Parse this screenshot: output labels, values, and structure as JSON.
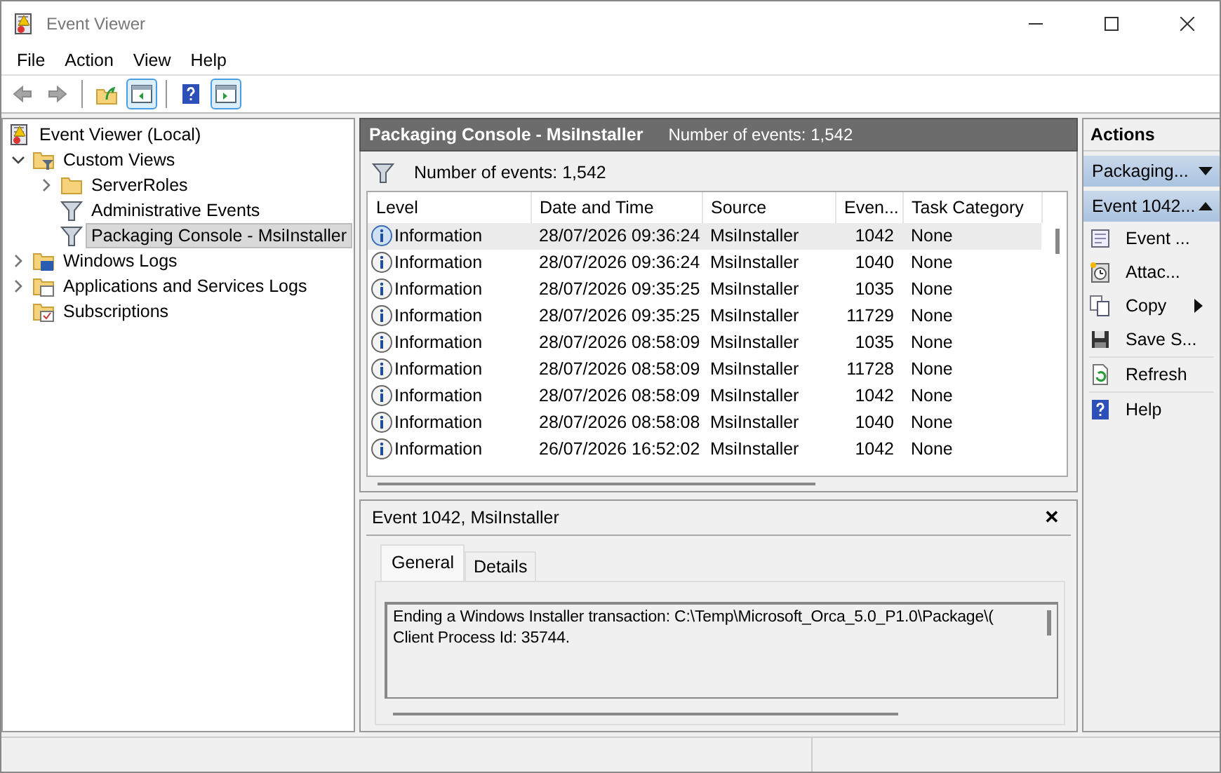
{
  "window": {
    "title": "Event Viewer"
  },
  "menu": [
    "File",
    "Action",
    "View",
    "Help"
  ],
  "toolbar": [
    {
      "kind": "back",
      "disabled": true
    },
    {
      "kind": "forward",
      "disabled": true
    },
    {
      "kind": "sep"
    },
    {
      "kind": "up",
      "disabled": false
    },
    {
      "kind": "pane-left",
      "disabled": false,
      "selected": true
    },
    {
      "kind": "sep"
    },
    {
      "kind": "help",
      "disabled": false
    },
    {
      "kind": "pane-right",
      "disabled": false,
      "selected": true
    }
  ],
  "tree": [
    {
      "label": "Event Viewer (Local)",
      "kind": "viewer",
      "selected": false,
      "children": [
        {
          "label": "Custom Views",
          "kind": "filter-folder",
          "expanded": true,
          "selected": false,
          "children": [
            {
              "label": "ServerRoles",
              "kind": "folder",
              "expanded": false,
              "selected": false
            },
            {
              "label": "Administrative Events",
              "kind": "filter",
              "selected": false
            },
            {
              "label": "Packaging Console - MsiInstaller",
              "kind": "filter",
              "selected": true
            }
          ]
        },
        {
          "label": "Windows Logs",
          "kind": "log-folder",
          "expanded": false,
          "selected": false
        },
        {
          "label": "Applications and Services Logs",
          "kind": "doc-folder",
          "expanded": false,
          "selected": false
        },
        {
          "label": "Subscriptions",
          "kind": "sub-folder",
          "selected": false
        }
      ]
    }
  ],
  "log_header": {
    "title": "Packaging Console - MsiInstaller",
    "count": "Number of events: 1,542"
  },
  "filter_bar": {
    "text": "Number of events: 1,542"
  },
  "table": {
    "columns": [
      "Level",
      "Date and Time",
      "Source",
      "Even...",
      "Task Category"
    ],
    "rows": [
      {
        "level": "Information",
        "date": "28/07/2026 09:36:24",
        "source": "MsiInstaller",
        "event": "1042",
        "category": "None",
        "selected": true
      },
      {
        "level": "Information",
        "date": "28/07/2026 09:36:24",
        "source": "MsiInstaller",
        "event": "1040",
        "category": "None",
        "selected": false
      },
      {
        "level": "Information",
        "date": "28/07/2026 09:35:25",
        "source": "MsiInstaller",
        "event": "1035",
        "category": "None",
        "selected": false
      },
      {
        "level": "Information",
        "date": "28/07/2026 09:35:25",
        "source": "MsiInstaller",
        "event": "11729",
        "category": "None",
        "selected": false
      },
      {
        "level": "Information",
        "date": "28/07/2026 08:58:09",
        "source": "MsiInstaller",
        "event": "1035",
        "category": "None",
        "selected": false
      },
      {
        "level": "Information",
        "date": "28/07/2026 08:58:09",
        "source": "MsiInstaller",
        "event": "11728",
        "category": "None",
        "selected": false
      },
      {
        "level": "Information",
        "date": "28/07/2026 08:58:09",
        "source": "MsiInstaller",
        "event": "1042",
        "category": "None",
        "selected": false
      },
      {
        "level": "Information",
        "date": "28/07/2026 08:58:08",
        "source": "MsiInstaller",
        "event": "1040",
        "category": "None",
        "selected": false
      },
      {
        "level": "Information",
        "date": "26/07/2026 16:52:02",
        "source": "MsiInstaller",
        "event": "1042",
        "category": "None",
        "selected": false
      }
    ]
  },
  "details": {
    "title": "Event 1042, MsiInstaller",
    "close": "✕",
    "tabs": [
      {
        "label": "General",
        "selected": true
      },
      {
        "label": "Details",
        "selected": false
      }
    ],
    "lines": [
      "Ending a Windows Installer transaction: C:\\Temp\\Microsoft_Orca_5.0_P1.0\\Package\\(",
      "Client Process Id: 35744."
    ]
  },
  "actions": {
    "title": "Actions",
    "sections": [
      {
        "label": "Packaging...",
        "expanded": false
      },
      {
        "label": "Event 1042...",
        "expanded": true,
        "items": [
          {
            "label": "Event ...",
            "kind": "properties",
            "submenu": false,
            "separator": false
          },
          {
            "label": "Attac...",
            "kind": "task",
            "submenu": false,
            "separator": false
          },
          {
            "label": "Copy",
            "kind": "copy",
            "submenu": true,
            "separator": false
          },
          {
            "label": "Save S...",
            "kind": "save",
            "submenu": false,
            "separator": false
          },
          {
            "label": "Refresh",
            "kind": "refresh",
            "submenu": false,
            "separator": true
          },
          {
            "label": "Help",
            "kind": "help",
            "submenu": false,
            "separator": true
          }
        ]
      }
    ]
  }
}
